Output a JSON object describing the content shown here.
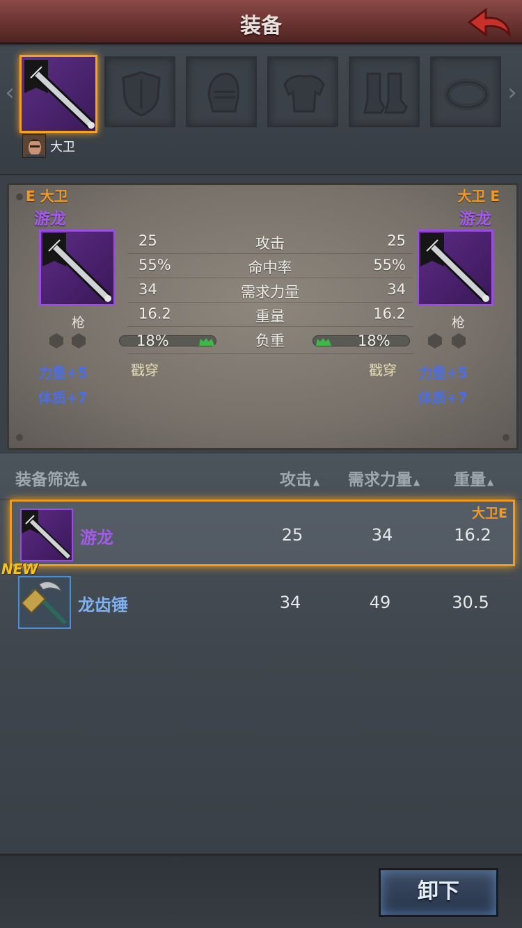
{
  "header": {
    "title": "装备"
  },
  "owner": {
    "name": "大卫"
  },
  "compare": {
    "left": {
      "equipped_tag": "E 大卫",
      "item_name": "游龙",
      "type": "枪",
      "bonuses": [
        "力量+5",
        "体质+7"
      ]
    },
    "right": {
      "equipped_tag": "大卫 E",
      "item_name": "游龙",
      "type": "枪",
      "bonuses": [
        "力量+5",
        "体质+7"
      ]
    },
    "stats": [
      {
        "label": "攻击",
        "left": "25",
        "right": "25"
      },
      {
        "label": "命中率",
        "left": "55%",
        "right": "55%"
      },
      {
        "label": "需求力量",
        "left": "34",
        "right": "34"
      },
      {
        "label": "重量",
        "left": "16.2",
        "right": "16.2"
      }
    ],
    "load": {
      "label": "负重",
      "left": "18%",
      "right": "18%",
      "fill_fraction": 0.18
    },
    "special": {
      "left": "戳穿",
      "right": "戳穿"
    }
  },
  "list": {
    "headers": {
      "filter": "装备筛选",
      "attack": "攻击",
      "req_str": "需求力量",
      "weight": "重量"
    },
    "items": [
      {
        "name": "游龙",
        "attack": "25",
        "req_str": "34",
        "weight": "16.2",
        "equipped_by": "大卫E",
        "badge": ""
      },
      {
        "name": "龙齿锤",
        "attack": "34",
        "req_str": "49",
        "weight": "30.5",
        "equipped_by": "",
        "badge": "NEW"
      }
    ]
  },
  "footer": {
    "unequip_label": "卸下"
  },
  "colors": {
    "accent_orange": "#f39a20",
    "rarity_purple": "#a35be8",
    "rarity_blue": "#4a8ed8",
    "bonus_blue": "#4d6ee0"
  }
}
